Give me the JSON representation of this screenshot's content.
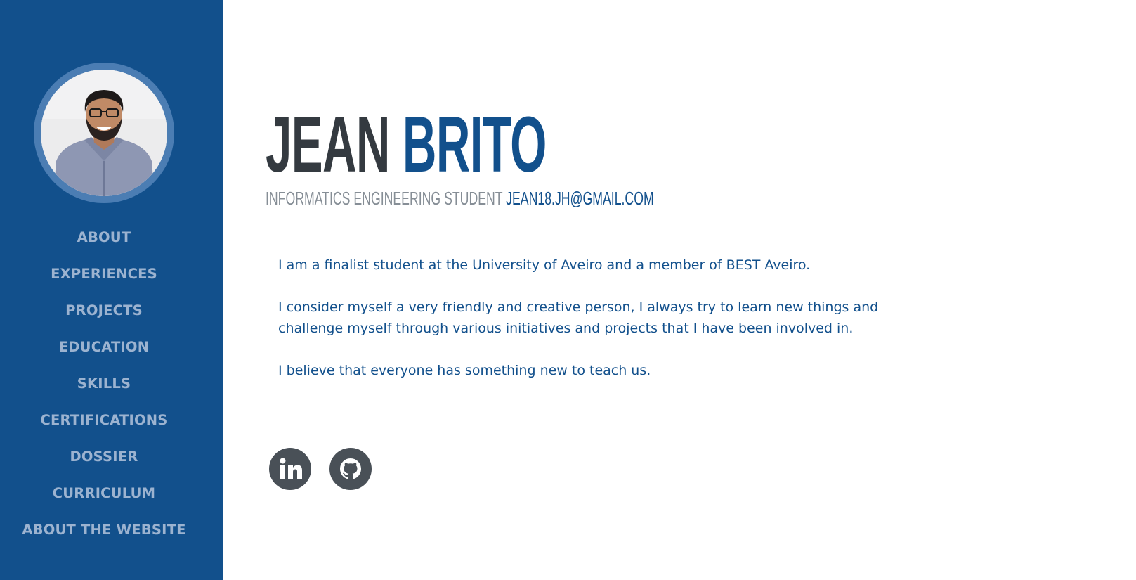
{
  "sidebar": {
    "avatar_alt": "Jean Brito profile photo",
    "nav_items": [
      {
        "label": "ABOUT"
      },
      {
        "label": "EXPERIENCES"
      },
      {
        "label": "PROJECTS"
      },
      {
        "label": "EDUCATION"
      },
      {
        "label": "SKILLS"
      },
      {
        "label": "CERTIFICATIONS"
      },
      {
        "label": "DOSSIER"
      },
      {
        "label": "CURRICULUM"
      },
      {
        "label": "ABOUT THE WEBSITE"
      }
    ]
  },
  "header": {
    "first_name": "JEAN",
    "last_name": "BRITO",
    "role": "INFORMATICS ENGINEERING STUDENT",
    "email": "JEAN18.JH@GMAIL.COM"
  },
  "bio": {
    "paragraphs": [
      "I am a finalist student at the University of Aveiro and a member of BEST Aveiro.",
      "I consider myself a very friendly and creative person, I always try to learn new things and challenge myself through various initiatives and projects that I have been involved in.",
      "I believe that everyone has something new to teach us."
    ]
  },
  "social": {
    "icons": [
      "linkedin-icon",
      "github-icon"
    ]
  },
  "colors": {
    "sidebar": "#12508c",
    "accent": "#12508c",
    "dark_text": "#343a40",
    "muted_text": "#868e96",
    "nav_text": "#9cb3d0",
    "social_bg": "#495057"
  }
}
